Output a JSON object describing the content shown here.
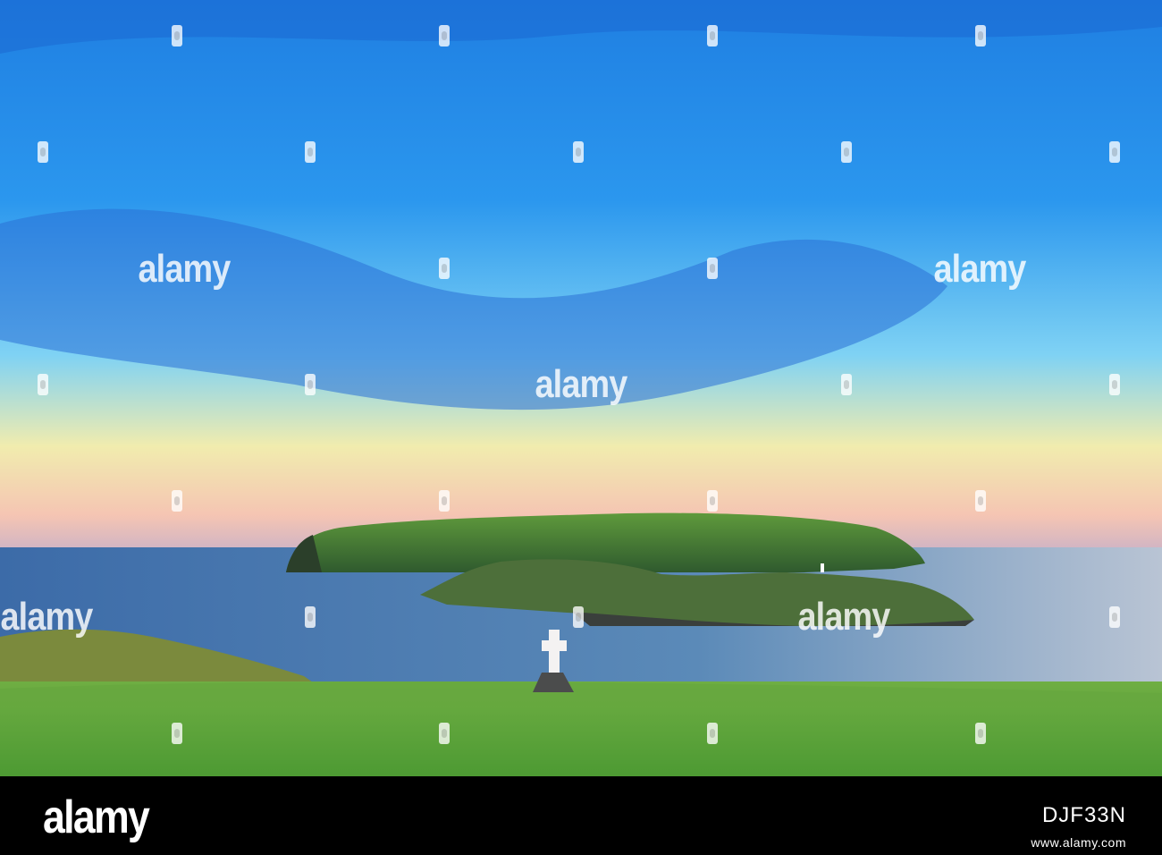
{
  "image": {
    "description_colors": {
      "sky_top": "#1d7fe0",
      "sky_mid": "#3ea8f0",
      "horizon_yellow": "#f4e7a8",
      "horizon_pink": "#f3b6b6",
      "sea": "#3f6fa6",
      "grass": "#5aa63c"
    }
  },
  "watermarks": {
    "brand": "alamy"
  },
  "footer": {
    "logo": "alamy",
    "image_id": "DJF33N",
    "url": "www.alamy.com"
  }
}
